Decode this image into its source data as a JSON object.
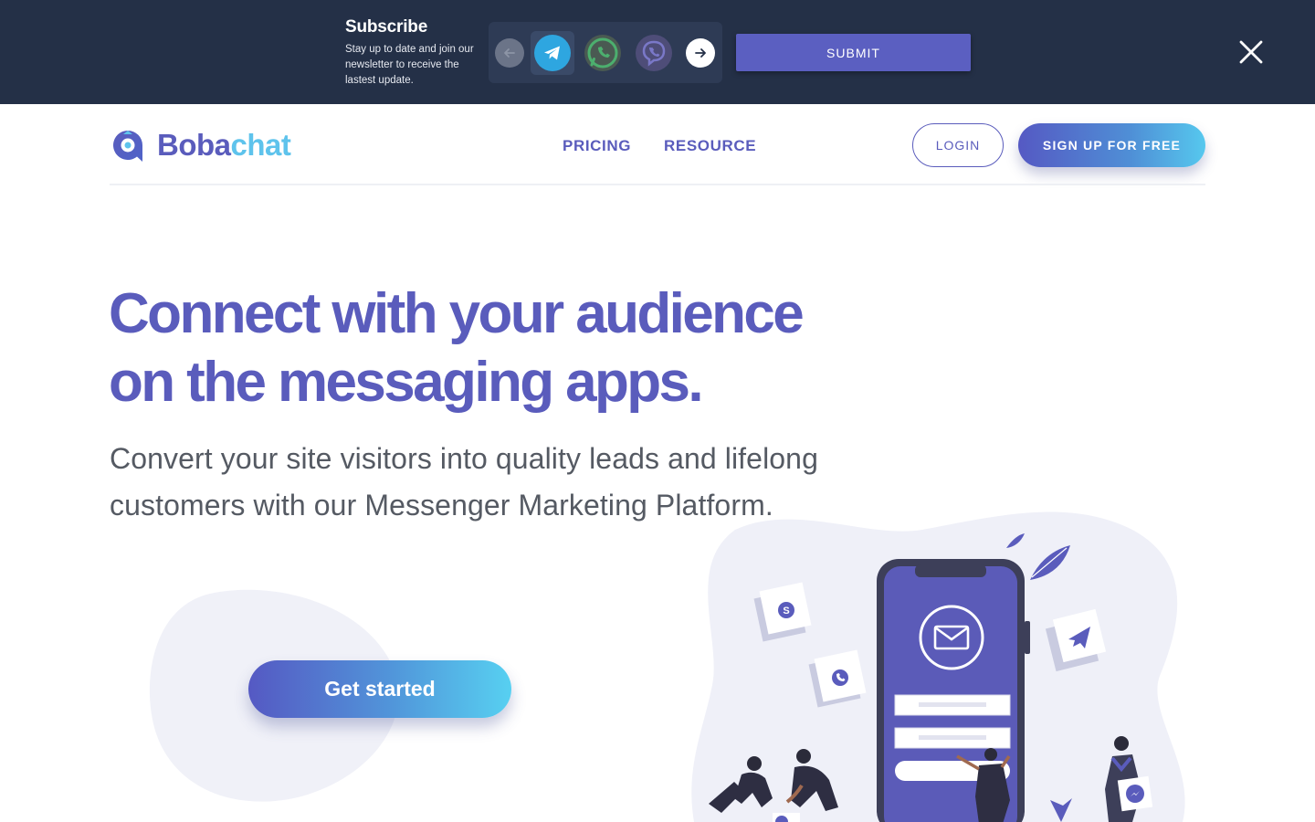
{
  "banner": {
    "title": "Subscribe",
    "description": "Stay up to date and join our newsletter to receive the lastest update.",
    "submit_label": "SUBMIT",
    "apps": [
      "telegram-icon",
      "whatsapp-icon",
      "viber-icon"
    ],
    "background_color": "#243047"
  },
  "nav": {
    "logo_part1": "Boba",
    "logo_part2": "chat",
    "links": [
      "PRICING",
      "RESOURCE"
    ],
    "login_label": "LOGIN",
    "signup_label": "SIGN UP FOR FREE"
  },
  "hero": {
    "headline_line1": "Connect with your audience",
    "headline_line2": "on the messaging apps.",
    "subheadline": "Convert your site visitors into quality leads and lifelong customers with our Messenger Marketing Platform.",
    "cta_label": "Get started"
  },
  "colors": {
    "brand_purple": "#5a5cbc",
    "brand_cyan": "#5ec3ec",
    "text_gray": "#555a63",
    "telegram_blue": "#2ea6e0"
  }
}
